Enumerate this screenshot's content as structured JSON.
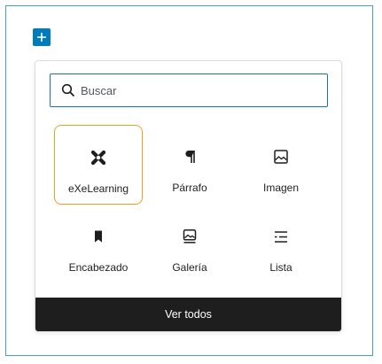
{
  "toolbar": {
    "add_block_icon": "plus-icon",
    "accent_color": "#007cba"
  },
  "inserter": {
    "search": {
      "placeholder": "Buscar",
      "value": "",
      "icon": "search-icon",
      "border_color": "#1e6fa8"
    },
    "blocks": [
      {
        "label": "eXeLearning",
        "icon": "exelearning-icon",
        "selected": true
      },
      {
        "label": "Párrafo",
        "icon": "paragraph-icon",
        "selected": false
      },
      {
        "label": "Imagen",
        "icon": "image-icon",
        "selected": false
      },
      {
        "label": "Encabezado",
        "icon": "heading-bookmark-icon",
        "selected": false
      },
      {
        "label": "Galería",
        "icon": "gallery-icon",
        "selected": false
      },
      {
        "label": "Lista",
        "icon": "list-icon",
        "selected": false
      }
    ],
    "selected_border_color": "#f0a020",
    "browse_all_label": "Ver todos"
  }
}
